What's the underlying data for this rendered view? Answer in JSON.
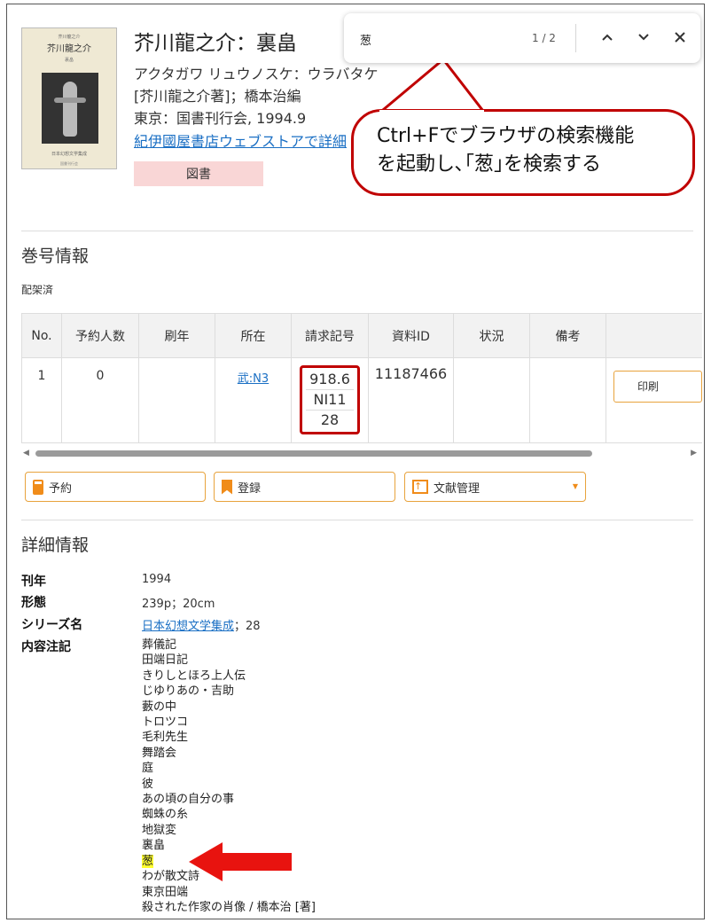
{
  "record": {
    "cover": {
      "author": "芥川龍之介",
      "title": "芥川龍之介",
      "series": "裏畠",
      "publisher": "日本幻想文学集成",
      "publisher2": "国書刊行会"
    },
    "title": "芥川龍之介：裏畠",
    "reading": "アクタガワ リュウノスケ：ウラバタケ",
    "responsibility": "[芥川龍之介著]；橋本治編",
    "publication": "東京：国書刊行会, 1994.9",
    "store_link": "紀伊國屋書店ウェブストアで詳細",
    "badge": "図書"
  },
  "find_bar": {
    "query": "葱",
    "count": "1 / 2",
    "prev_glyph": "⌃",
    "next_glyph": "⌄",
    "close_glyph": "✕"
  },
  "callout": {
    "line1": "Ctrl+Fでブラウザの検索機能",
    "line2": "を起動し､｢葱｣を検索する"
  },
  "holdings": {
    "section_title": "巻号情報",
    "status_label": "配架済",
    "columns": [
      "No.",
      "予約人数",
      "刷年",
      "所在",
      "請求記号",
      "資料ID",
      "状況",
      "備考",
      ""
    ],
    "row": {
      "no": "1",
      "reservations": "0",
      "print_year": "",
      "location": "武:N3",
      "call_number": [
        "918.6",
        "NI11",
        "28"
      ],
      "material_id": "11187466",
      "status": "",
      "notes": "",
      "print_button": "印刷"
    }
  },
  "actions": {
    "reserve": "予約",
    "register": "登録",
    "reference": "文献管理"
  },
  "details": {
    "section_title": "詳細情報",
    "pub_year_label": "刊年",
    "pub_year": "1994",
    "format_label": "形態",
    "format": "239p；20cm",
    "series_label": "シリーズ名",
    "series_link": "日本幻想文学集成",
    "series_suffix": "；28",
    "contents_label": "内容注記",
    "contents": [
      "葬儀記",
      "田端日記",
      "きりしとほろ上人伝",
      "じゆりあの・吉助",
      "藪の中",
      "トロツコ",
      "毛利先生",
      "舞踏会",
      "庭",
      "彼",
      "あの頃の自分の事",
      "蜘蛛の糸",
      "地獄変",
      "裏畠",
      "葱",
      "わが散文詩",
      "東京田端",
      "殺された作家の肖像 / 橋本治 [著]"
    ],
    "highlight_index": 14
  },
  "colors": {
    "accent": "#e8a33d",
    "link": "#1a6fc4",
    "annotation_red": "#c00000",
    "highlight": "#ffff30",
    "badge_bg": "#f9d6d6"
  }
}
